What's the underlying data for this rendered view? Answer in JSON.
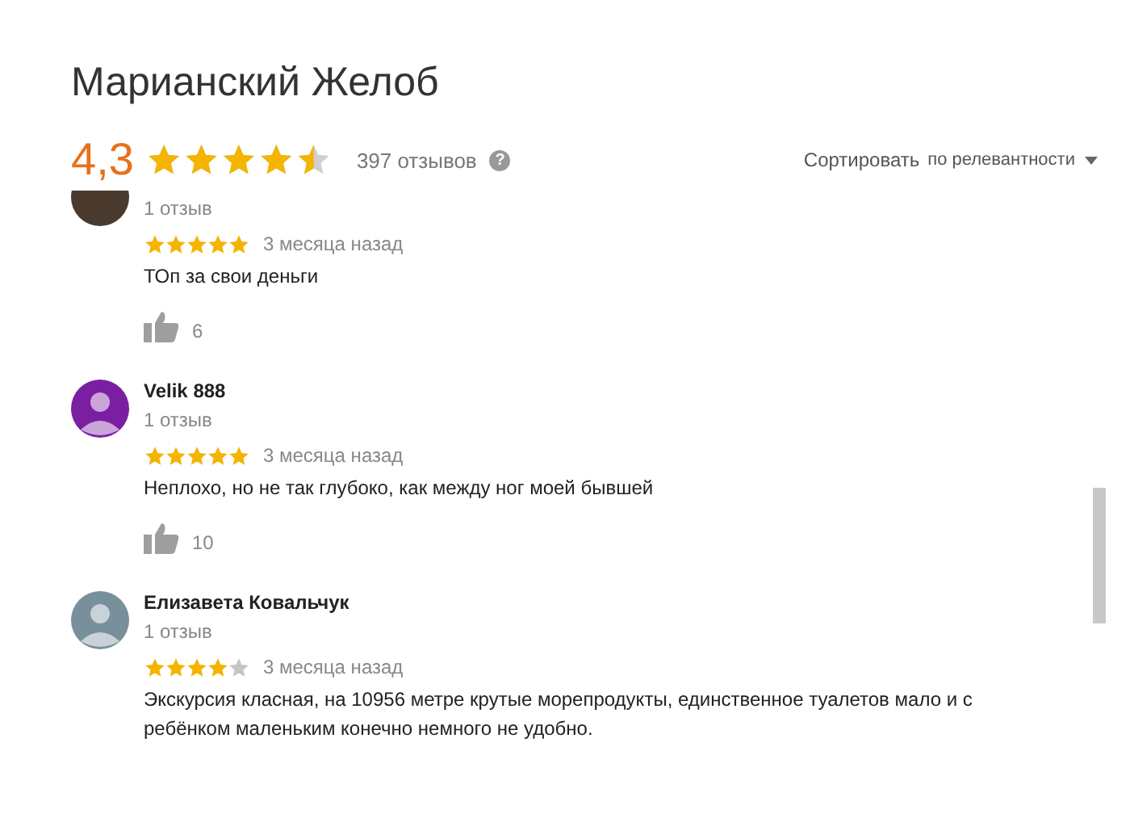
{
  "title": "Марианский Желоб",
  "rating": {
    "value": "4,3",
    "stars": 4.5,
    "count": "397 отзывов",
    "help": "?"
  },
  "sort": {
    "label": "Сортировать",
    "value": "по релевантности"
  },
  "reviews": [
    {
      "kind": "photo",
      "reviews_count": "1 отзыв",
      "stars": 5,
      "date": "3 месяца назад",
      "text": "ТОп за свои деньги",
      "likes": "6"
    },
    {
      "kind": "silhouette",
      "color": "#7b1fa2",
      "author": "Velik 888",
      "reviews_count": "1 отзыв",
      "stars": 5,
      "date": "3 месяца назад",
      "text": "Неплохо, но не так глубоко, как между ног моей бывшей",
      "likes": "10"
    },
    {
      "kind": "silhouette",
      "color": "#78909c",
      "author": "Елизавета Ковальчук",
      "reviews_count": "1 отзыв",
      "stars": 4,
      "date": "3 месяца назад",
      "text": "Экскурсия класная, на 10956 метре крутые морепродукты, единственное туалетов мало и с ребёнком маленьким конечно немного не удобно."
    }
  ]
}
